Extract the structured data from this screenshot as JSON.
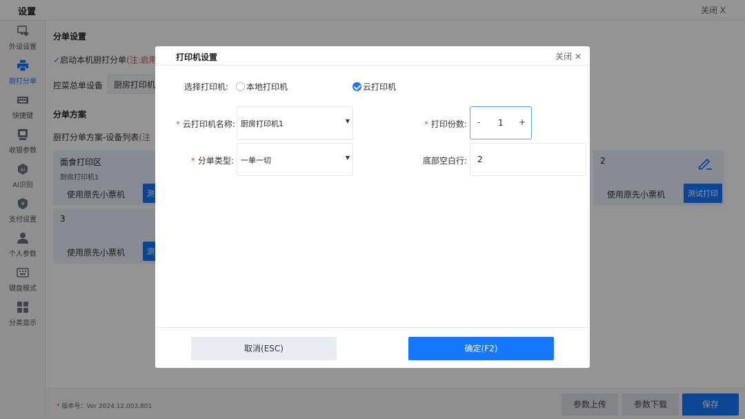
{
  "window": {
    "title": "设置",
    "close_label": "关闭 X"
  },
  "sidebar": {
    "items": [
      {
        "label": "外设设置",
        "icon": "monitor-gear-icon"
      },
      {
        "label": "厨打分单",
        "icon": "printer-icon",
        "active": true
      },
      {
        "label": "快捷键",
        "icon": "keyboard-icon"
      },
      {
        "label": "收银参数",
        "icon": "register-icon"
      },
      {
        "label": "AI识别",
        "icon": "ai-icon"
      },
      {
        "label": "支付设置",
        "icon": "payment-shield-icon"
      },
      {
        "label": "个人参数",
        "icon": "person-icon"
      },
      {
        "label": "键盘模式",
        "icon": "keyboard-mode-icon"
      },
      {
        "label": "分类显示",
        "icon": "grid-icon"
      }
    ]
  },
  "main": {
    "split_settings_title": "分单设置",
    "enable_local_label": "启动本机厨打分单",
    "enable_local_note": "(注:启用",
    "control_device_label": "控菜总单设备",
    "control_device_value": "厨房打印机",
    "split_plan_title": "分单方案",
    "plan_list_label": "厨打分单方案-设备列表",
    "plan_list_note": "(注",
    "cards": [
      {
        "name": "面食打印区",
        "sub": "厨房打印机1",
        "use": "使用原先小票机",
        "test": "测"
      },
      {
        "name": "3",
        "use": "使用原先小票机",
        "test": "测"
      },
      {
        "name": "2",
        "use": "使用原先小票机",
        "test": "测试打印"
      }
    ]
  },
  "footer": {
    "version_prefix": "* ",
    "version": "版本号：Ver 2024.12.003.801",
    "upload_label": "参数上传",
    "download_label": "参数下载",
    "save_label": "保存"
  },
  "modal": {
    "title": "打印机设置",
    "close_label": "关闭 ✕",
    "select_printer_label": "选择打印机:",
    "radio_local": "本地打印机",
    "radio_cloud": "云打印机",
    "selected_printer_type": "云打印机",
    "cloud_name_label": "云打印机名称:",
    "cloud_name_value": "厨房打印机1",
    "copies_label": "打印份数:",
    "copies_value": "1",
    "split_type_label": "分单类型:",
    "split_type_value": "一单一切",
    "bottom_blank_label": "底部空白行:",
    "bottom_blank_value": "2",
    "required_mark": "*",
    "minus": "-",
    "plus": "+",
    "cancel_label": "取消(ESC)",
    "ok_label": "确定(F2)"
  },
  "colors": {
    "accent": "#1677ff",
    "required": "#e54545"
  }
}
